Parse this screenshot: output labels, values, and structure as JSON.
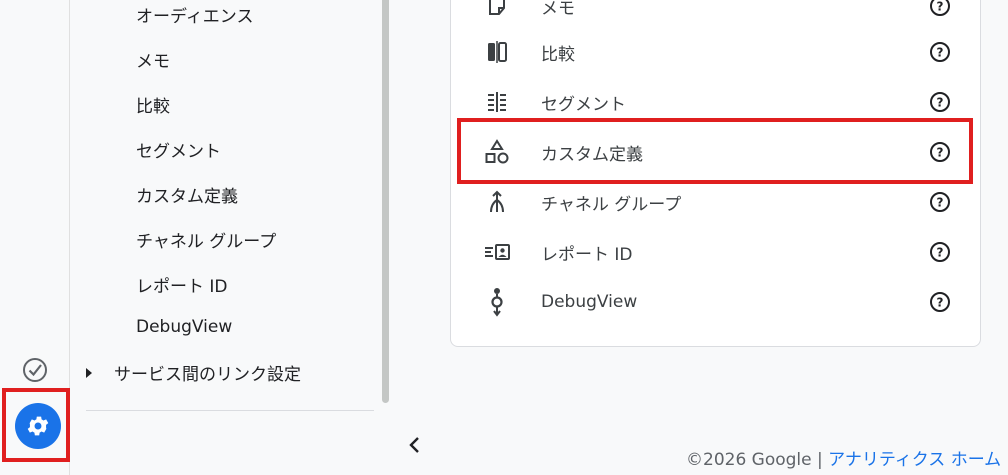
{
  "sidenav": {
    "items": [
      {
        "label": "オーディエンス"
      },
      {
        "label": "メモ"
      },
      {
        "label": "比較"
      },
      {
        "label": "セグメント"
      },
      {
        "label": "カスタム定義"
      },
      {
        "label": "チャネル グループ"
      },
      {
        "label": "レポート ID"
      },
      {
        "label": "DebugView"
      }
    ],
    "parent_label": "サービス間のリンク設定"
  },
  "panel": {
    "rows": [
      {
        "label": "メモ",
        "icon": "memo-icon"
      },
      {
        "label": "比較",
        "icon": "compare-icon"
      },
      {
        "label": "セグメント",
        "icon": "segment-icon"
      },
      {
        "label": "カスタム定義",
        "icon": "shapes-icon"
      },
      {
        "label": "チャネル グループ",
        "icon": "merge-icon"
      },
      {
        "label": "レポート ID",
        "icon": "report-id-icon"
      },
      {
        "label": "DebugView",
        "icon": "debug-icon"
      }
    ]
  },
  "footer": {
    "copyright": "©2026 Google |",
    "link": "アナリティクス ホーム"
  },
  "colors": {
    "accent": "#1a73e8",
    "highlight": "#e01f1f"
  }
}
